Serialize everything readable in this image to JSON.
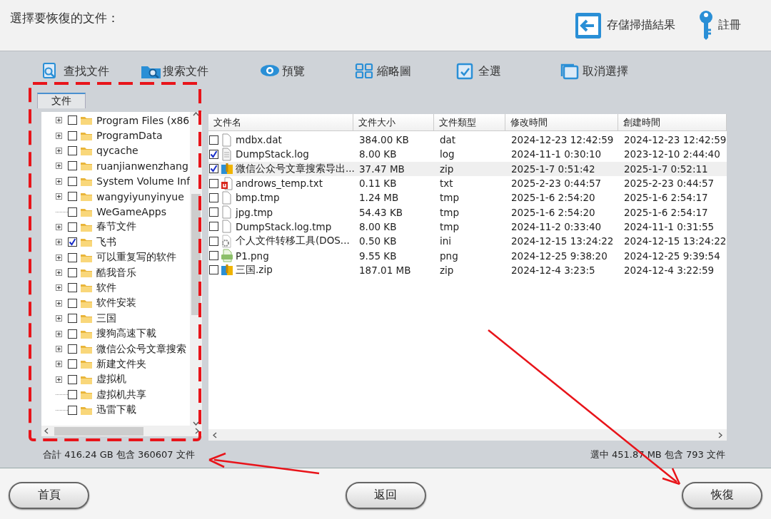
{
  "header": {
    "title": "選擇要恢復的文件：",
    "actions": [
      {
        "label": "存儲掃描結果"
      },
      {
        "label": "註冊"
      }
    ]
  },
  "toolbar": [
    {
      "label": "查找文件"
    },
    {
      "label": "搜索文件"
    },
    {
      "label": "預覽"
    },
    {
      "label": "縮略圖"
    },
    {
      "label": "全選"
    },
    {
      "label": "取消選擇"
    }
  ],
  "tree": {
    "tab": {
      "label": "文件",
      "selected": true
    },
    "items": [
      {
        "label": "Program Files (x86",
        "expandable": true,
        "checked": false
      },
      {
        "label": "ProgramData",
        "expandable": true,
        "checked": false
      },
      {
        "label": "qycache",
        "expandable": true,
        "checked": false
      },
      {
        "label": "ruanjianwenzhang",
        "expandable": true,
        "checked": false
      },
      {
        "label": "System Volume Inf",
        "expandable": true,
        "checked": false
      },
      {
        "label": "wangyiyunyinyue",
        "expandable": true,
        "checked": false
      },
      {
        "label": "WeGameApps",
        "expandable": false,
        "checked": false
      },
      {
        "label": "春节文件",
        "expandable": true,
        "checked": false
      },
      {
        "label": "飞书",
        "expandable": true,
        "checked": true
      },
      {
        "label": "可以重复写的软件",
        "expandable": true,
        "checked": false
      },
      {
        "label": "酷我音乐",
        "expandable": true,
        "checked": false
      },
      {
        "label": "软件",
        "expandable": true,
        "checked": false
      },
      {
        "label": "软件安装",
        "expandable": true,
        "checked": false
      },
      {
        "label": "三国",
        "expandable": true,
        "checked": false
      },
      {
        "label": "搜狗高速下載",
        "expandable": true,
        "checked": false
      },
      {
        "label": "微信公众号文章搜索",
        "expandable": true,
        "checked": false
      },
      {
        "label": "新建文件夹",
        "expandable": true,
        "checked": false
      },
      {
        "label": "虚拟机",
        "expandable": true,
        "checked": false
      },
      {
        "label": "虚拟机共享",
        "expandable": false,
        "checked": false
      },
      {
        "label": "迅雷下載",
        "expandable": false,
        "checked": false
      }
    ]
  },
  "files": {
    "columns": [
      "文件名",
      "文件大小",
      "文件類型",
      "修改時間",
      "創建時間"
    ],
    "rows": [
      {
        "kind": "blank",
        "checked": false,
        "selected": false,
        "cells": [
          "mdbx.dat",
          "384.00 KB",
          "dat",
          "2024-12-23 12:42:59",
          "2024-12-23 12:42:59"
        ]
      },
      {
        "kind": "text",
        "checked": true,
        "selected": false,
        "cells": [
          "DumpStack.log",
          "8.00 KB",
          "log",
          "2024-11-1 0:30:10",
          "2023-12-10 2:44:40"
        ]
      },
      {
        "kind": "archive",
        "checked": true,
        "selected": true,
        "cells": [
          "微信公众号文章搜索导出...",
          "37.47 MB",
          "zip",
          "2025-1-7 0:51:42",
          "2025-1-7 0:52:11"
        ]
      },
      {
        "kind": "document",
        "checked": false,
        "selected": false,
        "cells": [
          "androws_temp.txt",
          "0.11 KB",
          "txt",
          "2025-2-23 0:44:57",
          "2025-2-23 0:44:57"
        ]
      },
      {
        "kind": "blank",
        "checked": false,
        "selected": false,
        "cells": [
          "bmp.tmp",
          "1.24 MB",
          "tmp",
          "2025-1-6 2:54:20",
          "2025-1-6 2:54:17"
        ]
      },
      {
        "kind": "blank",
        "checked": false,
        "selected": false,
        "cells": [
          "jpg.tmp",
          "54.43 KB",
          "tmp",
          "2025-1-6 2:54:20",
          "2025-1-6 2:54:17"
        ]
      },
      {
        "kind": "blank",
        "checked": false,
        "selected": false,
        "cells": [
          "DumpStack.log.tmp",
          "8.00 KB",
          "tmp",
          "2024-11-2 0:33:40",
          "2024-11-1 0:31:55"
        ]
      },
      {
        "kind": "config",
        "checked": false,
        "selected": false,
        "cells": [
          "个人文件转移工具(DOS...",
          "0.50 KB",
          "ini",
          "2024-12-15 13:24:22",
          "2024-12-15 13:24:22"
        ]
      },
      {
        "kind": "image",
        "checked": false,
        "selected": false,
        "cells": [
          "P1.png",
          "9.55 KB",
          "png",
          "2024-12-25 9:38:20",
          "2024-12-25 9:39:54"
        ]
      },
      {
        "kind": "archive",
        "checked": false,
        "selected": false,
        "cells": [
          "三国.zip",
          "187.01 MB",
          "zip",
          "2024-12-4 3:23:5",
          "2024-12-4 3:22:59"
        ]
      }
    ]
  },
  "status_bar": {
    "total": "合計 416.24 GB 包含 360607 文件",
    "selected": "選中 451.87 MB 包含 793 文件"
  },
  "buttons": [
    {
      "label": "首頁"
    },
    {
      "label": "返回"
    },
    {
      "label": "恢復"
    }
  ]
}
